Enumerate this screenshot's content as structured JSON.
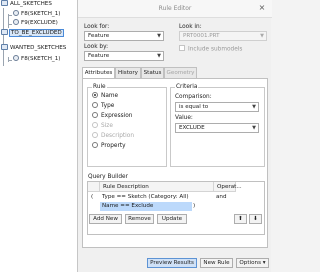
{
  "tree": {
    "items": [
      {
        "label": "ALL_SKETCHES",
        "kind": "folder",
        "icon": "folder-icon"
      },
      {
        "label": "F8(SKETCH_1)",
        "kind": "feature",
        "icon": "sketch-feature-icon"
      },
      {
        "label": "F9(EXCLUDE)",
        "kind": "feature",
        "icon": "sketch-feature-icon"
      },
      {
        "label": "TO_BE_EXCLUDED",
        "kind": "folder",
        "icon": "folder-icon",
        "selected": true
      },
      {
        "label": "WANTED_SKETCHES",
        "kind": "folder",
        "icon": "folder-icon"
      },
      {
        "label": "F8(SKETCH_1)",
        "kind": "feature",
        "icon": "sketch-feature-icon"
      }
    ]
  },
  "dialog": {
    "title": "Rule Editor",
    "close_glyph": "×",
    "look_for": {
      "label": "Look for:",
      "value": "Feature"
    },
    "look_in": {
      "label": "Look in:",
      "value": "PRT0001.PRT"
    },
    "look_by": {
      "label": "Look by:",
      "value": "Feature"
    },
    "include_submodels": "Include submodels",
    "tabs": [
      {
        "label": "Attributes",
        "active": true
      },
      {
        "label": "History"
      },
      {
        "label": "Status"
      },
      {
        "label": "Geometry",
        "disabled": true
      }
    ],
    "rule": {
      "title": "Rule",
      "options": [
        {
          "label": "Name",
          "checked": true
        },
        {
          "label": "Type"
        },
        {
          "label": "Expression"
        },
        {
          "label": "Size",
          "disabled": true
        },
        {
          "label": "Description",
          "disabled": true
        },
        {
          "label": "Property"
        }
      ]
    },
    "criteria": {
      "title": "Criteria",
      "comparison_label": "Comparison:",
      "comparison_value": "is equal to",
      "value_label": "Value:",
      "value_value": "EXCLUDE"
    },
    "query": {
      "title": "Query Builder",
      "columns": [
        "Rule Description",
        "Operat..."
      ],
      "rows": [
        {
          "open": "(",
          "desc": "Type  ==  Sketch (Category: All)",
          "close": "",
          "op": "and"
        },
        {
          "open": "",
          "desc": "Name  ==  Exclude",
          "close": ")",
          "op": "",
          "selected": true
        }
      ],
      "buttons": {
        "add": "Add New",
        "remove": "Remove",
        "update": "Update"
      },
      "up_glyph": "⬆",
      "down_glyph": "⬇"
    },
    "footer": {
      "preview": "Preview Results",
      "new_rule": "New Rule",
      "options": "Options",
      "caret": "▾"
    }
  }
}
